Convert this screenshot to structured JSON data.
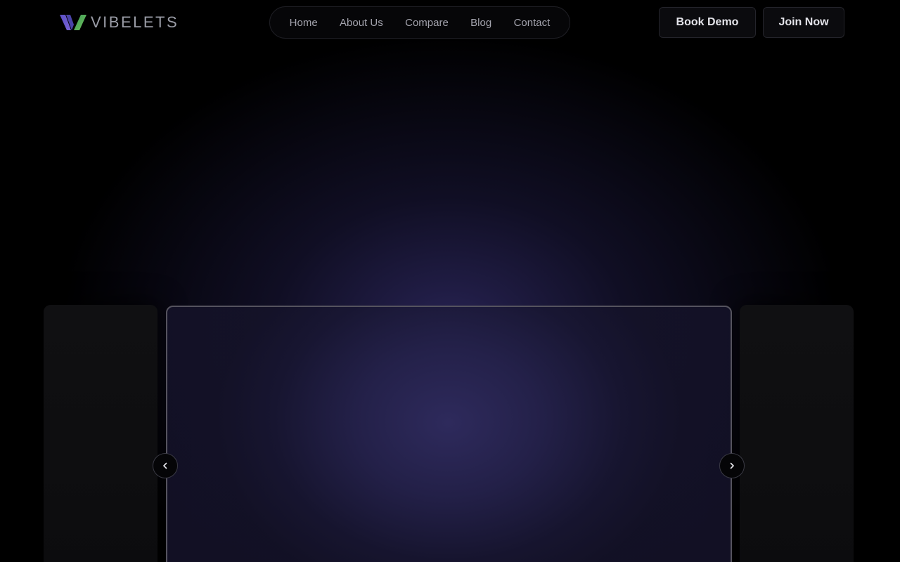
{
  "brand": {
    "name": "VIBELETS",
    "logo_icon": "vibelets-logo-icon"
  },
  "nav": {
    "items": [
      {
        "label": "Home"
      },
      {
        "label": "About Us"
      },
      {
        "label": "Compare"
      },
      {
        "label": "Blog"
      },
      {
        "label": "Contact"
      }
    ]
  },
  "actions": {
    "book_demo_label": "Book Demo",
    "join_now_label": "Join Now"
  },
  "carousel": {
    "prev_icon": "chevron-left-icon",
    "next_icon": "chevron-right-icon"
  },
  "colors": {
    "background": "#000000",
    "accent_purple": "#5a4fc0",
    "accent_green": "#4cae6a",
    "card_glow": "#2e2a5c"
  }
}
